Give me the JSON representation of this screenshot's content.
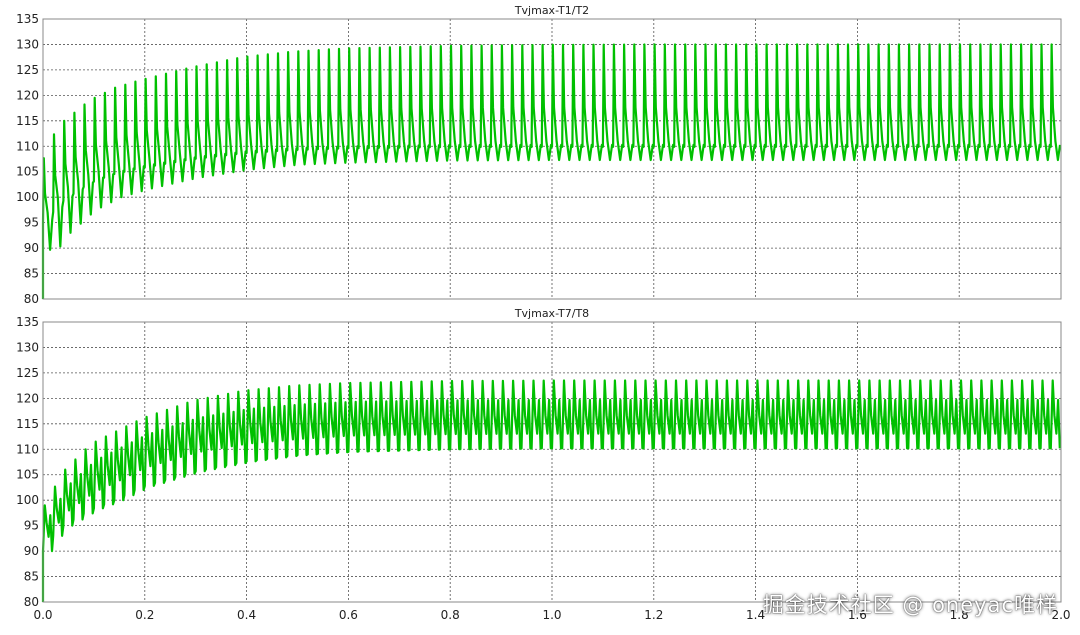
{
  "chart_data": [
    {
      "type": "line",
      "title": "Tvjmax-T1/T2",
      "x_ticks": [
        "0.0",
        "0.2",
        "0.4",
        "0.6",
        "0.8",
        "1.0",
        "1.2",
        "1.4",
        "1.6",
        "1.8",
        "2.0"
      ],
      "y_ticks": [
        "80",
        "85",
        "90",
        "95",
        "100",
        "105",
        "110",
        "115",
        "120",
        "125",
        "130",
        "135"
      ],
      "xlim": [
        0,
        2.0
      ],
      "ylim": [
        80,
        135
      ],
      "grid": true,
      "series": [
        {
          "color": "#00c000",
          "envelope": {
            "upper_x": [
              0.0,
              0.005,
              0.02,
              0.05,
              0.1,
              0.15,
              0.2,
              0.3,
              0.4,
              0.5,
              0.6,
              0.8,
              1.0,
              1.2,
              1.6,
              2.0
            ],
            "upper_y": [
              80,
              106,
              111,
              115,
              119,
              121.5,
              123,
              125.5,
              127.5,
              128.6,
              129.2,
              129.7,
              129.9,
              130,
              130,
              130
            ],
            "lower_x": [
              0.0,
              0.005,
              0.02,
              0.05,
              0.1,
              0.15,
              0.2,
              0.3,
              0.4,
              0.5,
              0.6,
              0.8,
              1.0,
              1.2,
              1.6,
              2.0
            ],
            "lower_y": [
              80,
              90,
              89,
              93,
              97.5,
              100,
              101.5,
              103.8,
              105.4,
              106.4,
              106.8,
              107.2,
              107.3,
              107.3,
              107.3,
              107.3
            ],
            "mid_y": [
              80,
              96,
              99,
              102,
              105,
              106.5,
              107.5,
              109,
              110,
              110.5,
              110.8,
              111,
              111,
              111,
              111,
              111
            ]
          },
          "period": 0.02
        }
      ]
    },
    {
      "type": "line",
      "title": "Tvjmax-T7/T8",
      "x_ticks": [
        "0.0",
        "0.2",
        "0.4",
        "0.6",
        "0.8",
        "1.0",
        "1.2",
        "1.4",
        "1.6",
        "1.8",
        "2.0"
      ],
      "y_ticks": [
        "80",
        "85",
        "90",
        "95",
        "100",
        "105",
        "110",
        "115",
        "120",
        "125",
        "130",
        "135"
      ],
      "xlim": [
        0,
        2.0
      ],
      "ylim": [
        80,
        135
      ],
      "grid": true,
      "series": [
        {
          "color": "#00c000",
          "envelope": {
            "upper_x": [
              0.0,
              0.005,
              0.02,
              0.05,
              0.1,
              0.15,
              0.2,
              0.3,
              0.4,
              0.5,
              0.6,
              0.8,
              1.0,
              1.2,
              1.6,
              2.0
            ],
            "upper_y": [
              80,
              98,
              101,
              106,
              111,
              113.5,
              116,
              119.5,
              121.5,
              122.5,
              123,
              123.4,
              123.5,
              123.5,
              123.5,
              123.5
            ],
            "lower_x": [
              0.0,
              0.005,
              0.02,
              0.05,
              0.1,
              0.15,
              0.2,
              0.3,
              0.4,
              0.5,
              0.6,
              0.8,
              1.0,
              1.2,
              1.6,
              2.0
            ],
            "lower_y": [
              80,
              89,
              92,
              95,
              98,
              100,
              102.5,
              105.5,
              107.5,
              108.8,
              109.5,
              110,
              110.2,
              110.2,
              110.2,
              110.2
            ],
            "mid_y": [
              80,
              94,
              96,
              100,
              104,
              106.5,
              109,
              112,
              113.5,
              114.2,
              114.8,
              115,
              115,
              115,
              115,
              115
            ]
          },
          "period": 0.02
        }
      ]
    }
  ],
  "watermark": "掘金技术社区 @ oneyac唯样"
}
